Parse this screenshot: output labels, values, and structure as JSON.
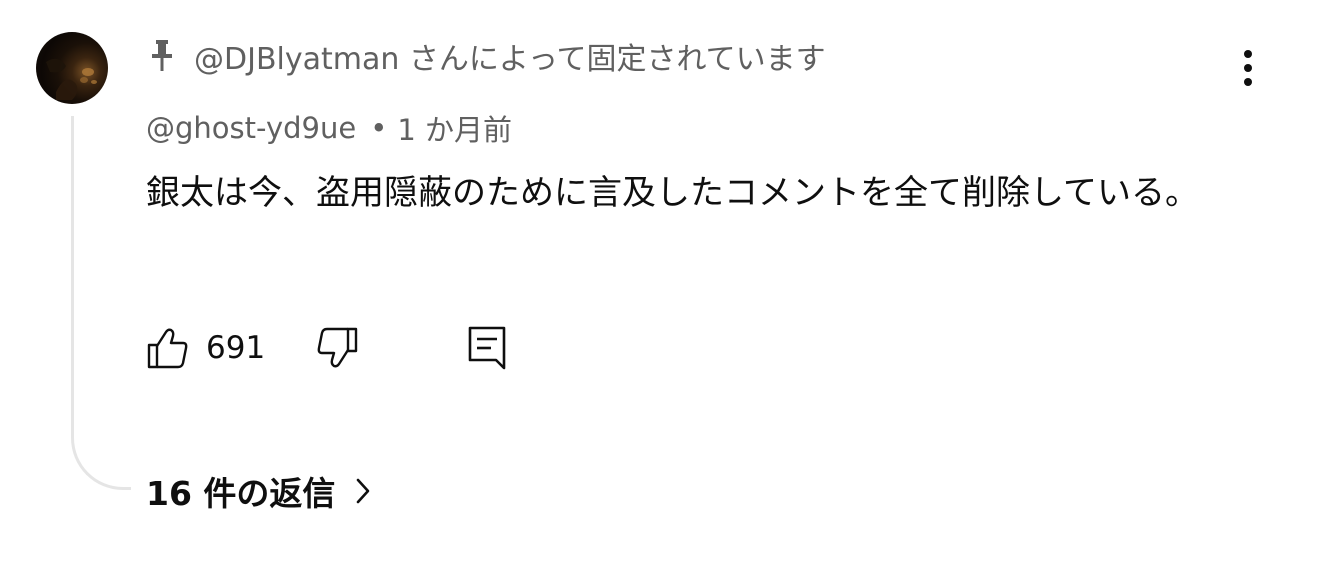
{
  "comment": {
    "pinned_label": "@DJBlyatman さんによって固定されています",
    "author": "@ghost-yd9ue",
    "separator": "•",
    "timestamp": "1 か月前",
    "text": "銀太は今、盗用隠蔽のために言及したコメントを全て削除している。",
    "like_count": "691",
    "replies_label": "16 件の返信"
  },
  "icons": {
    "pin": "pin-icon",
    "more": "more-vertical-icon",
    "like": "thumbs-up-icon",
    "dislike": "thumbs-down-icon",
    "reply": "reply-comment-icon",
    "chevron": "chevron-right-icon"
  },
  "colors": {
    "primary_text": "#0f0f0f",
    "secondary_text": "#606060",
    "thread_line": "#e5e5e5"
  }
}
